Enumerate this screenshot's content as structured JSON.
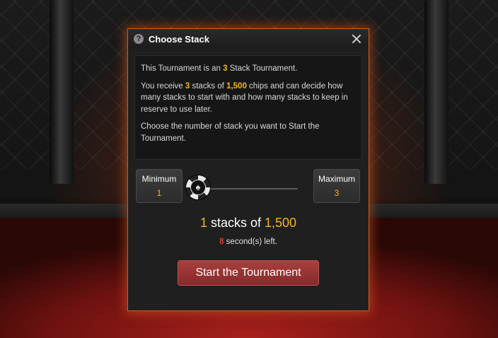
{
  "dialog": {
    "title": "Choose Stack",
    "help_icon_glyph": "?",
    "close_icon": "close-icon"
  },
  "info": {
    "line1_pre": "This Tournament is an ",
    "line1_num": "3",
    "line1_post": " Stack Tournament.",
    "line2_a": "You receive ",
    "line2_num": "3",
    "line2_b": " stacks of ",
    "line2_chips": "1,500",
    "line2_c": " chips and can decide how many stacks to start with and how many stacks to keep in reserve to use later.",
    "line3": "Choose the number of stack you want to Start the Tournament."
  },
  "slider": {
    "min_label": "Minimum",
    "min_value": "1",
    "max_label": "Maximum",
    "max_value": "3",
    "chip_glyph": "♠",
    "position_fraction": 0
  },
  "summary": {
    "stacks_count": "1",
    "stacks_text": " stacks of ",
    "chips": "1,500"
  },
  "timer": {
    "seconds": "8",
    "text": " second(s) left."
  },
  "actions": {
    "start_label": "Start the Tournament"
  },
  "colors": {
    "accent_yellow": "#f3b71b",
    "timer_red": "#e8352a",
    "button_red": "#a8403e",
    "dialog_border": "#d05a24"
  }
}
